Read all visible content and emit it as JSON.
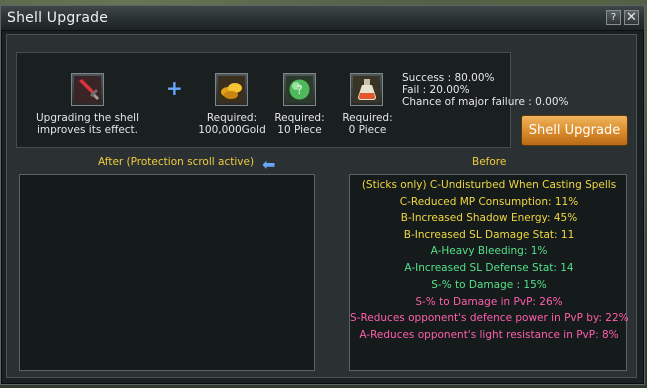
{
  "window": {
    "title": "Shell Upgrade",
    "help_label": "?",
    "close_label": "✕"
  },
  "materials": [
    {
      "icon": "sword-icon",
      "label_line1": "Upgrading the shell",
      "label_line2": "improves its effect."
    },
    {
      "icon": "gold-coins-icon",
      "label_line1": "Required:",
      "label_line2": "100,000Gold"
    },
    {
      "icon": "green-orb-icon",
      "label_line1": "Required:",
      "label_line2": "10 Piece"
    },
    {
      "icon": "potion-flask-icon",
      "label_line1": "Required:",
      "label_line2": "0 Piece"
    }
  ],
  "plus_symbol": "+",
  "stats": {
    "success": "Success : 80.00%",
    "fail": "Fail : 20.00%",
    "major_failure": "Chance of major failure : 0.00%"
  },
  "upgrade_button": "Shell Upgrade",
  "after_label": "After  (Protection scroll active)",
  "arrow_symbol": "⬅",
  "before_label": "Before",
  "colors": {
    "yellow": "#f0d840",
    "green": "#56e08a",
    "pink": "#ff5fae",
    "button_orange": "#d98b2b"
  },
  "before_effects": [
    {
      "text": "(Sticks only) C-Undisturbed When Casting Spells",
      "color": "#f0d840"
    },
    {
      "text": "C-Reduced MP Consumption: 11%",
      "color": "#f0d840"
    },
    {
      "text": "B-Increased Shadow Energy: 45%",
      "color": "#f0d840"
    },
    {
      "text": "B-Increased SL Damage Stat: 11",
      "color": "#f0d840"
    },
    {
      "text": "A-Heavy Bleeding: 1%",
      "color": "#56e08a"
    },
    {
      "text": "A-Increased SL Defense Stat: 14",
      "color": "#56e08a"
    },
    {
      "text": "S-% to Damage : 15%",
      "color": "#56e08a"
    },
    {
      "text": "S-% to Damage in PvP: 26%",
      "color": "#ff5fae"
    },
    {
      "text": "S-Reduces opponent's defence power in PvP by: 22%",
      "color": "#ff5fae"
    },
    {
      "text": "A-Reduces opponent's light resistance in PvP: 8%",
      "color": "#ff5fae"
    }
  ]
}
